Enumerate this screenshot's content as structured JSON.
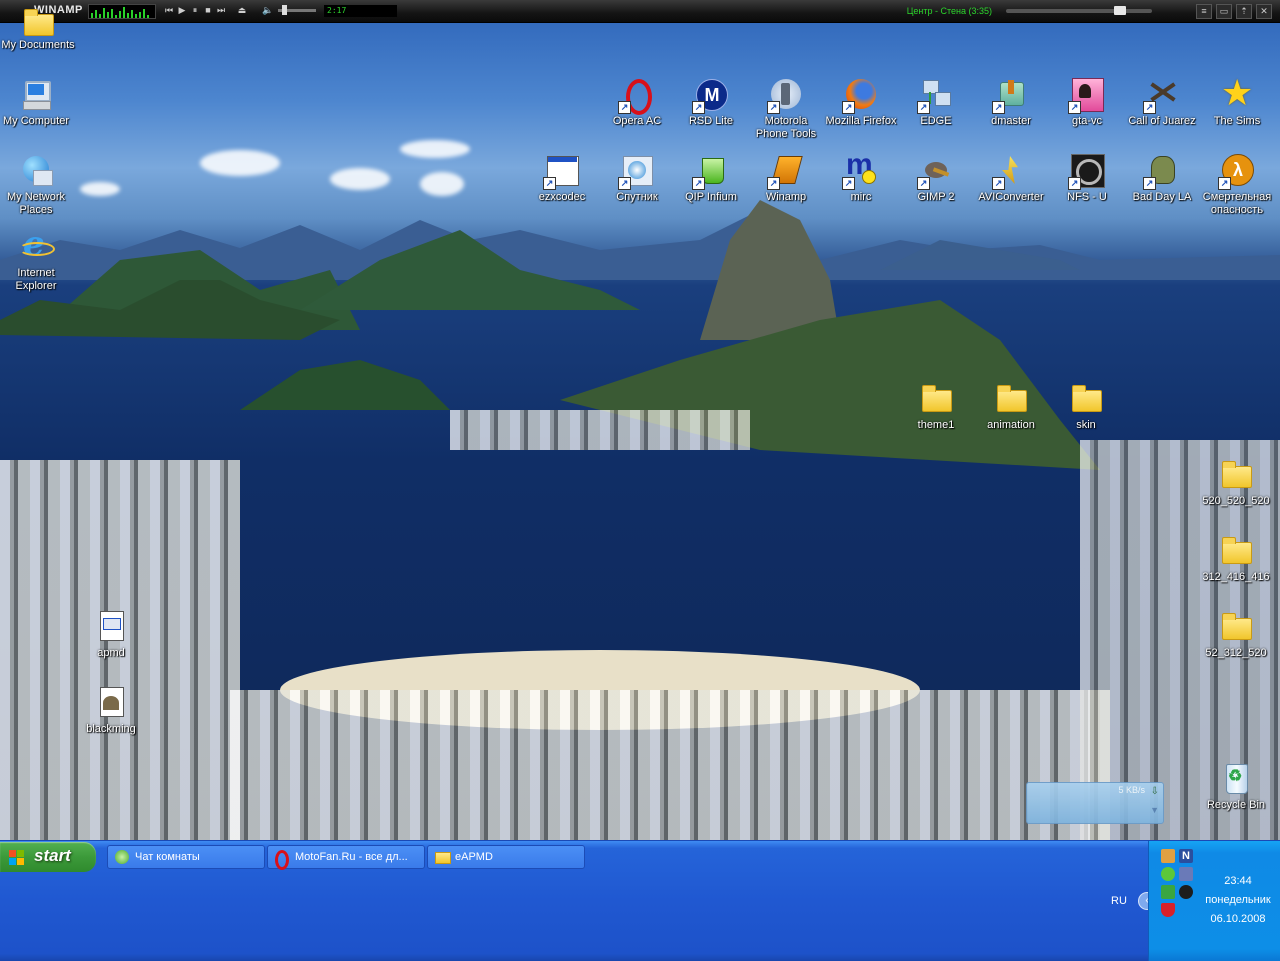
{
  "winamp": {
    "logo": "WINAMP",
    "time": "2:17",
    "track": "Центр - Стена (3:35)",
    "volume_level": 0.2,
    "seek_position": 0.75
  },
  "desktop": {
    "icons_left": [
      {
        "name": "my-documents",
        "label": "My Documents"
      },
      {
        "name": "my-computer",
        "label": "My Computer"
      },
      {
        "name": "my-network-places",
        "label": "My Network Places"
      },
      {
        "name": "internet-explorer",
        "label": "Internet Explorer"
      }
    ],
    "icons_row1": [
      {
        "label": "Opera AC"
      },
      {
        "label": "RSD Lite"
      },
      {
        "label": "Motorola Phone Tools"
      },
      {
        "label": "Mozilla Firefox"
      },
      {
        "label": "EDGE"
      },
      {
        "label": "dmaster"
      },
      {
        "label": "gta-vc"
      },
      {
        "label": "Call of Juarez"
      },
      {
        "label": "The Sims"
      }
    ],
    "icons_row2": [
      {
        "label": "ezxcodec"
      },
      {
        "label": "Спутник"
      },
      {
        "label": "QIP Infium"
      },
      {
        "label": "Winamp"
      },
      {
        "label": "mirc"
      },
      {
        "label": "GIMP 2"
      },
      {
        "label": "AVIConverter"
      },
      {
        "label": "NFS - U"
      },
      {
        "label": "Bad Day LA"
      },
      {
        "label": "Смертельная опасность"
      }
    ],
    "folders_mid": [
      {
        "label": "theme1"
      },
      {
        "label": "animation"
      },
      {
        "label": "skin"
      }
    ],
    "folders_right": [
      {
        "label": "520_520_520"
      },
      {
        "label": "312_416_416"
      },
      {
        "label": "52_312_520"
      }
    ],
    "files_left": [
      {
        "label": "apmd"
      },
      {
        "label": "blackming"
      }
    ],
    "recycle_bin": "Recycle Bin",
    "net_widget": {
      "speed": "5 KB/s"
    }
  },
  "taskbar": {
    "start_label": "start",
    "tasks": [
      {
        "label": "Чат комнаты"
      },
      {
        "label": "MotoFan.Ru - все дл..."
      },
      {
        "label": "eAPMD"
      }
    ],
    "language": "RU",
    "clock": {
      "time": "23:44",
      "day": "понедельник",
      "date": "06.10.2008"
    }
  }
}
